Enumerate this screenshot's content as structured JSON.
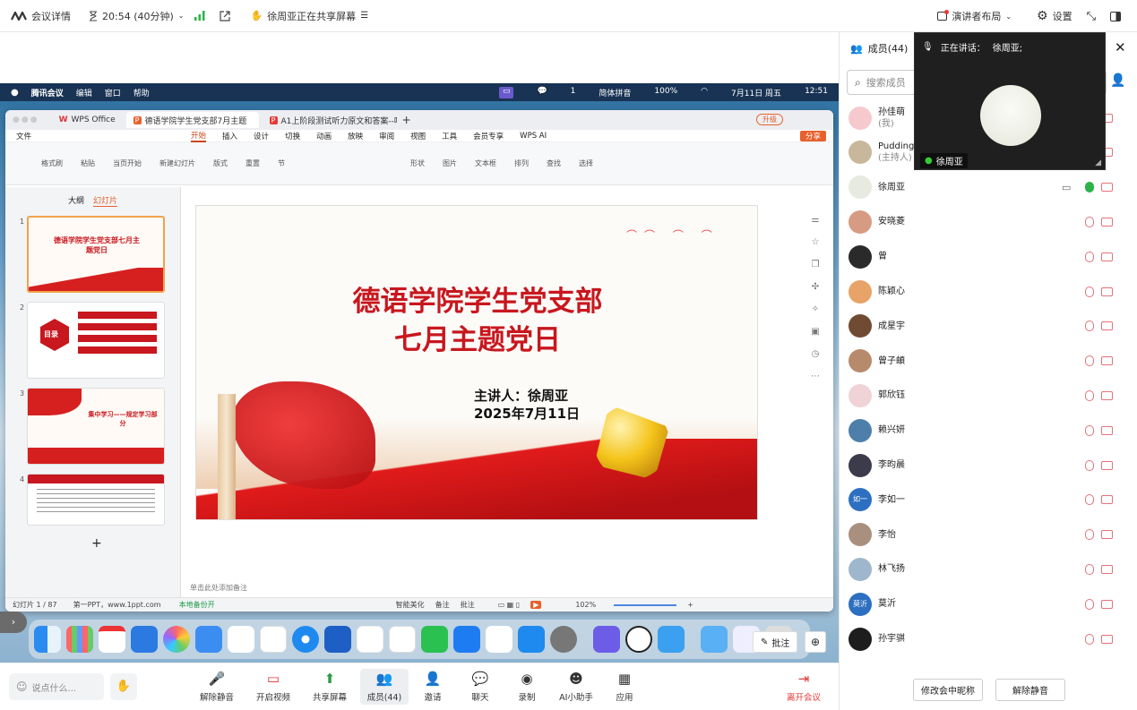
{
  "topbar": {
    "meeting_details": "会议详情",
    "timer": "20:54 (40分钟)",
    "sharing_status": "徐周亚正在共享屏幕",
    "presenter_layout": "演讲者布局",
    "settings": "设置"
  },
  "mac_menu": {
    "app": "腾讯会议",
    "items": [
      "编辑",
      "窗口",
      "帮助"
    ],
    "input_label": "简体拼音",
    "battery": "100%",
    "datetime": "7月11日 周五",
    "time": "12:51",
    "count": "1"
  },
  "wps": {
    "tabs": [
      "WPS Office",
      "德语学院学生党支部7月主题",
      "A1上阶段测试听力原文和答案--听"
    ],
    "upgrade": "升级",
    "share": "分享",
    "file_menu": "文件",
    "ribbon": [
      "开始",
      "插入",
      "设计",
      "切换",
      "动画",
      "放映",
      "审阅",
      "视图",
      "工具",
      "会员专享",
      "WPS AI"
    ],
    "tools": [
      "格式刷",
      "粘贴",
      "当页开始",
      "新建幻灯片",
      "版式",
      "重置",
      "节",
      "形状",
      "图片",
      "文本框",
      "排列",
      "查找",
      "选择"
    ],
    "panel_tabs": [
      "大纲",
      "幻灯片"
    ],
    "thumbs": [
      {
        "num": "1",
        "title": "德语学院学生党支部七月主题党日"
      },
      {
        "num": "2",
        "title": "目录"
      },
      {
        "num": "3",
        "title": "集中学习——规定学习部分"
      },
      {
        "num": "4",
        "title": ""
      }
    ],
    "slide_title": [
      "德语学院学生党支部",
      "七月主题党日"
    ],
    "slide_speaker": "主讲人：徐周亚",
    "slide_date": "2025年7月11日",
    "notes_placeholder": "单击此处添加备注",
    "status": {
      "slide_count": "幻灯片 1 / 87",
      "template": "第一PPT，www.1ppt.com",
      "backup": "本地备份开",
      "smart": "智能美化",
      "notes": "备注",
      "comments": "批注",
      "zoom": "102%"
    }
  },
  "overlay": {
    "annotate": "批注"
  },
  "bottom": {
    "chat_placeholder": "说点什么...",
    "buttons": [
      "解除静音",
      "开启视频",
      "共享屏幕",
      "成员(44)",
      "邀请",
      "聊天",
      "录制",
      "AI小助手",
      "应用"
    ],
    "leave": "离开会议"
  },
  "panel": {
    "title": "成员(44)",
    "search_placeholder": "搜索成员",
    "members": [
      {
        "name": "孙佳萌",
        "sub": "(我)",
        "color": "#f6c9cf"
      },
      {
        "name": "Pudding",
        "sub": "(主持人)",
        "color": "#c9b79c"
      },
      {
        "name": "徐周亚",
        "sub": "",
        "color": "#e7eadf"
      },
      {
        "name": "安晓菱",
        "sub": "",
        "color": "#d79b83"
      },
      {
        "name": "曾",
        "sub": "",
        "color": "#2a2a2a"
      },
      {
        "name": "陈颖心",
        "sub": "",
        "color": "#e7a368"
      },
      {
        "name": "成星宇",
        "sub": "",
        "color": "#6f4b33"
      },
      {
        "name": "曾子頔",
        "sub": "",
        "color": "#b88a6c"
      },
      {
        "name": "郭欣钰",
        "sub": "",
        "color": "#efd3d7"
      },
      {
        "name": "赖兴妍",
        "sub": "",
        "color": "#4d7faa"
      },
      {
        "name": "李昀晨",
        "sub": "",
        "color": "#3b3b4a"
      },
      {
        "name": "李如一",
        "sub": "",
        "color": "#2d6fc0",
        "initials": "如一"
      },
      {
        "name": "李怡",
        "sub": "",
        "color": "#a98f7e"
      },
      {
        "name": "林飞扬",
        "sub": "",
        "color": "#9fb7cc"
      },
      {
        "name": "莫沂",
        "sub": "",
        "color": "#2d6fc0",
        "initials": "莫沂"
      },
      {
        "name": "孙宇骐",
        "sub": "",
        "color": "#1d1d1d"
      }
    ],
    "rename_button": "修改会中昵称",
    "unmute_button": "解除静音"
  },
  "speaker": {
    "speaking_label": "正在讲话：",
    "speaking_name": "徐周亚;",
    "name_tag": "徐周亚"
  }
}
